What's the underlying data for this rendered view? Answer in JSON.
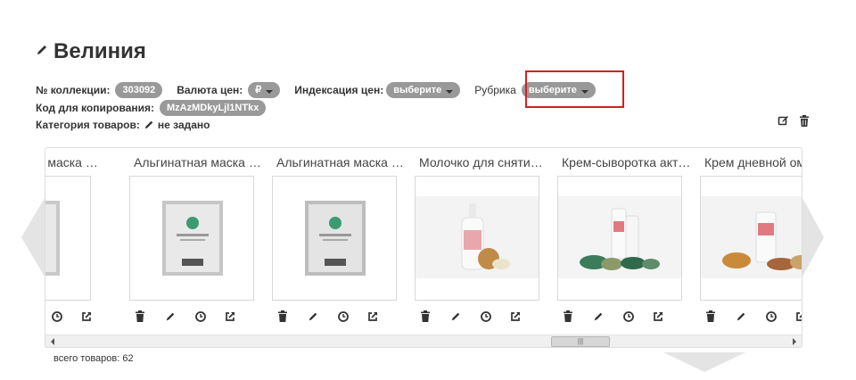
{
  "collection": {
    "title": "Велиния",
    "number_label": "№ коллекции:",
    "number_value": "303092",
    "currency_label": "Валюта цен:",
    "currency_value": "₽",
    "indexation_label": "Индексация цен:",
    "indexation_value": "выберите",
    "rubric_label": "Рубрика",
    "rubric_value": "выберите",
    "copy_code_label": "Код для копирования:",
    "copy_code_value": "MzAzMDkyLjl1NTkx",
    "category_label": "Категория товаров:",
    "category_value": "не задано"
  },
  "products": [
    {
      "title": "Альгинатная маска для лица",
      "image": "sachet"
    },
    {
      "title": "Альгинатная маска для лица",
      "image": "sachet"
    },
    {
      "title": "Альгинатная маска для лица",
      "image": "sachet"
    },
    {
      "title": "Молочко для снятия макияжа",
      "image": "bottle"
    },
    {
      "title": "Крем-сыворотка активная",
      "image": "tubes"
    },
    {
      "title": "Крем дневной омолаживающий",
      "image": "jar"
    }
  ],
  "total_label": "всего товаров: 62",
  "icons": {
    "edit": "pencil-icon",
    "delete": "trash-icon",
    "history": "clock-icon",
    "share": "share-icon",
    "edit_collection": "edit-square-icon"
  },
  "colors": {
    "pill_bg": "#999999",
    "highlight": "#d71e1e",
    "nav_arrow": "#e4e4e4"
  }
}
